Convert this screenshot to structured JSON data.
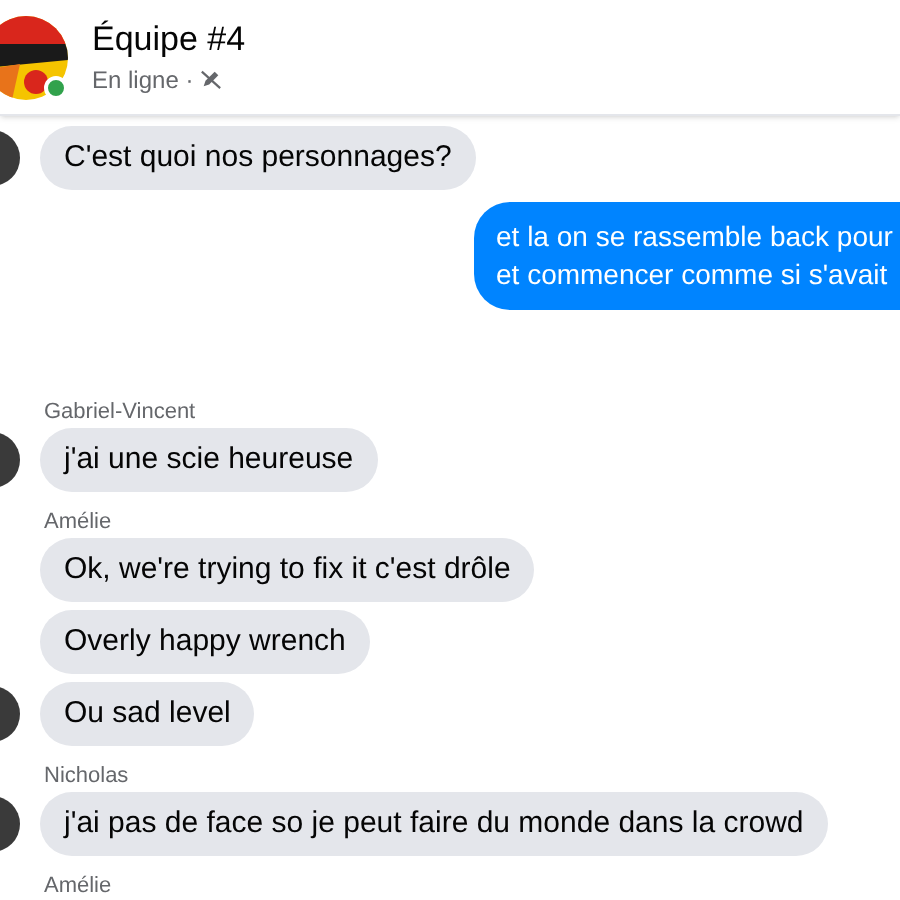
{
  "header": {
    "title": "Équipe #4",
    "status": "En ligne ·",
    "online": true
  },
  "messages": [
    {
      "kind": "incoming",
      "text": "C'est quoi nos personnages?",
      "avatar": true
    },
    {
      "kind": "outgoing",
      "lines": [
        "et la on se rassemble back pour",
        "et commencer comme si s'avait"
      ]
    },
    {
      "kind": "incoming",
      "sender": "Gabriel-Vincent",
      "text": "j'ai une scie heureuse",
      "avatar": true
    },
    {
      "kind": "incoming",
      "sender": "Amélie",
      "text": "Ok, we're trying to fix it c'est drôle",
      "avatar": false
    },
    {
      "kind": "incoming",
      "text": "Overly happy wrench",
      "avatar": false
    },
    {
      "kind": "incoming",
      "text": "Ou sad level",
      "avatar": true
    },
    {
      "kind": "incoming",
      "sender": "Nicholas",
      "text": "j'ai pas de face so je peut faire du monde dans la crowd",
      "avatar": true
    },
    {
      "kind": "incoming",
      "sender": "Amélie"
    }
  ]
}
